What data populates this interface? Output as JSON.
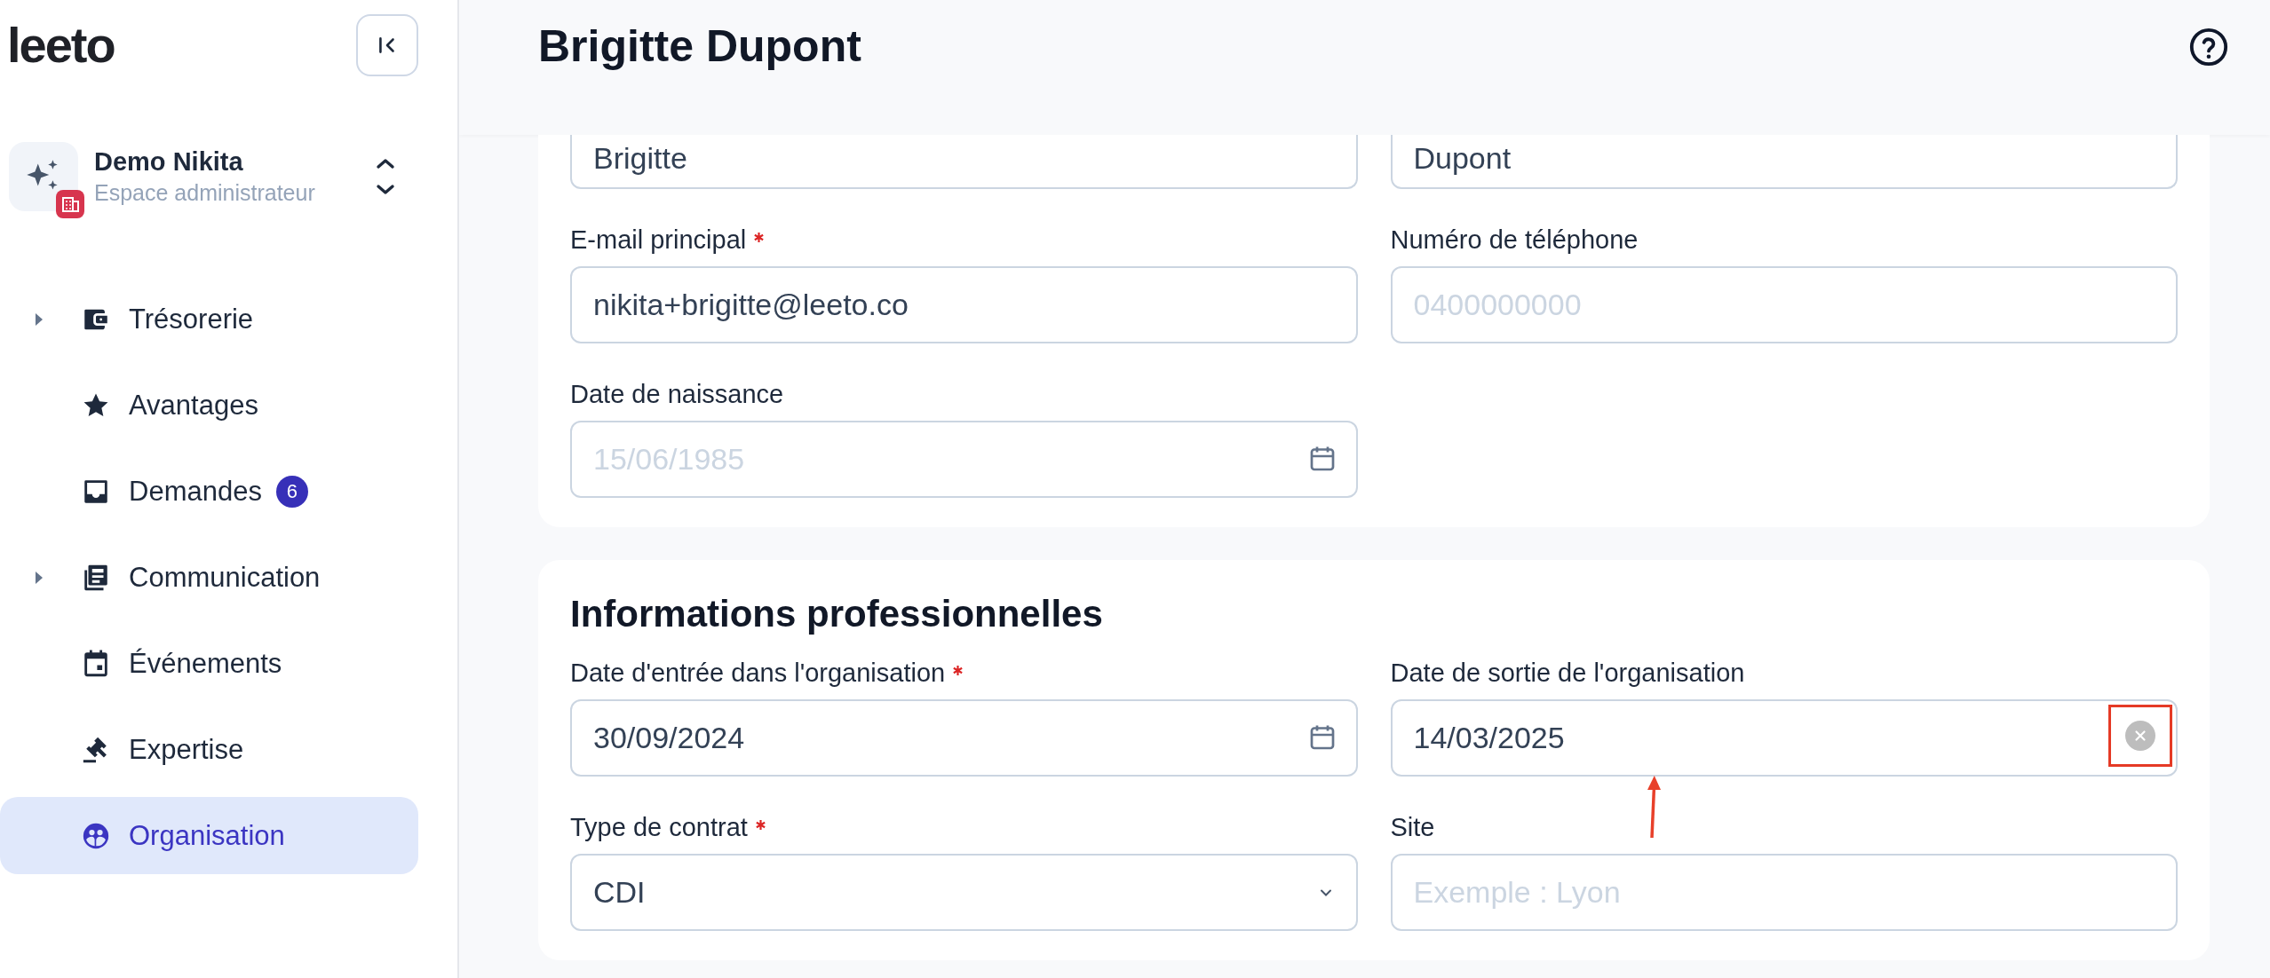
{
  "sidebar": {
    "logo": "leeto",
    "workspace": {
      "name": "Demo Nikita",
      "role": "Espace administrateur"
    },
    "nav": [
      {
        "label": "Trésorerie",
        "expandable": true,
        "selected": false
      },
      {
        "label": "Avantages",
        "expandable": false,
        "selected": false
      },
      {
        "label": "Demandes",
        "expandable": false,
        "selected": false,
        "badge": "6"
      },
      {
        "label": "Communication",
        "expandable": true,
        "selected": false
      },
      {
        "label": "Événements",
        "expandable": false,
        "selected": false
      },
      {
        "label": "Expertise",
        "expandable": false,
        "selected": false
      },
      {
        "label": "Organisation",
        "expandable": false,
        "selected": true
      }
    ]
  },
  "page": {
    "title": "Brigitte Dupont"
  },
  "sections": [
    {
      "fields": [
        {
          "kind": "text",
          "value": "Brigitte"
        },
        {
          "kind": "text",
          "value": "Dupont"
        },
        {
          "kind": "text",
          "label": "E-mail principal",
          "required": true,
          "value": "nikita+brigitte@leeto.co"
        },
        {
          "kind": "text",
          "label": "Numéro de téléphone",
          "required": false,
          "placeholder": "0400000000"
        },
        {
          "kind": "date",
          "label": "Date de naissance",
          "required": false,
          "placeholder": "15/06/1985",
          "clearable": false
        }
      ]
    },
    {
      "title": "Informations professionnelles",
      "fields": [
        {
          "kind": "date",
          "label": "Date d'entrée dans l'organisation",
          "required": true,
          "value": "30/09/2024",
          "clearable": false
        },
        {
          "kind": "date",
          "label": "Date de sortie de l'organisation",
          "required": false,
          "value": "14/03/2025",
          "clearable": true
        },
        {
          "kind": "select",
          "label": "Type de contrat",
          "required": true,
          "value": "CDI"
        },
        {
          "kind": "text",
          "label": "Site",
          "required": false,
          "placeholder": "Exemple : Lyon"
        }
      ]
    }
  ]
}
